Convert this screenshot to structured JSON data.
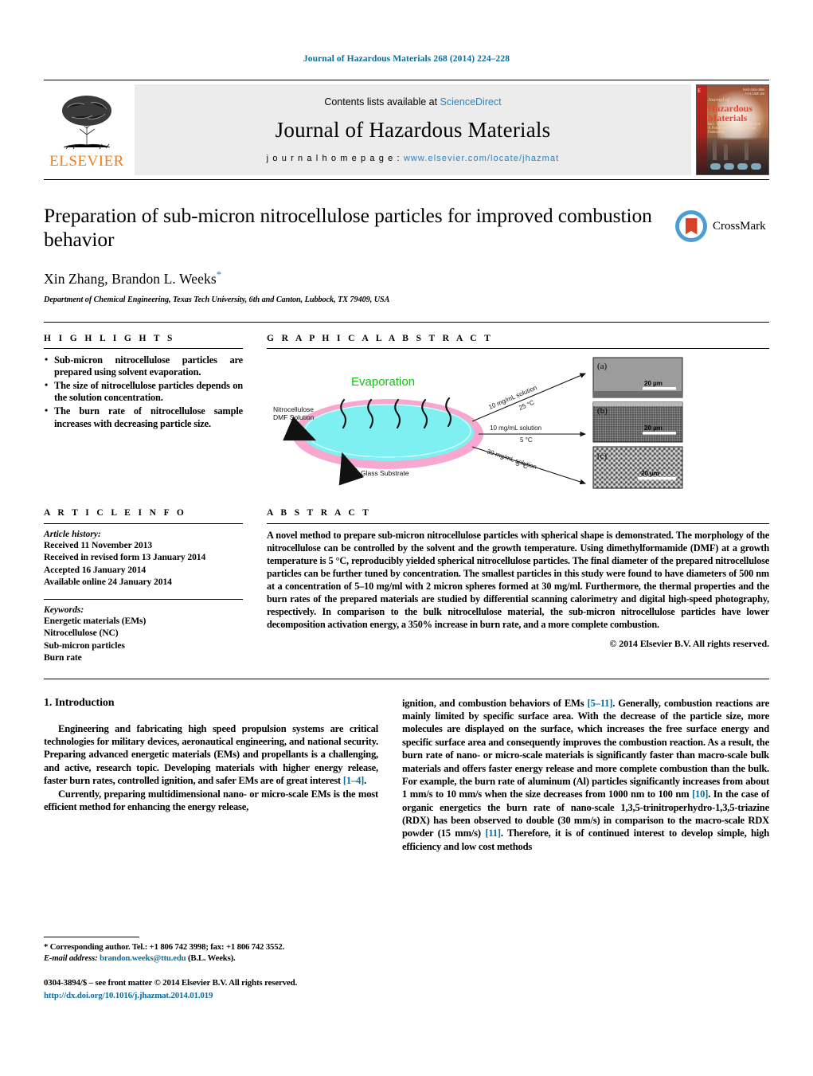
{
  "running_head": "Journal of Hazardous Materials 268 (2014) 224–228",
  "masthead": {
    "contents_prefix": "Contents lists available at ",
    "sciencedirect": "ScienceDirect",
    "journal_title": "Journal of Hazardous Materials",
    "homepage_prefix": "j o u r n a l   h o m e p a g e :   ",
    "homepage_url": "www.elsevier.com/locate/jhazmat",
    "elsevier_word": "ELSEVIER",
    "cover": {
      "line1": "Journal of",
      "line2": "Hazardous",
      "line3": "Materials",
      "line4": "Incl. Treatment and Management",
      "line5": "A Publication of the European Federation"
    }
  },
  "article": {
    "title": "Preparation of sub-micron nitrocellulose particles for improved combustion behavior",
    "authors": "Xin Zhang, Brandon L. Weeks",
    "affiliation": "Department of Chemical Engineering, Texas Tech University, 6th and Canton, Lubbock, TX 79409, USA",
    "crossmark_label": "CrossMark"
  },
  "highlights": {
    "heading": "H I G H L I G H T S",
    "items": [
      "Sub-micron nitrocellulose particles are prepared using solvent evaporation.",
      "The size of nitrocellulose particles depends on the solution concentration.",
      "The burn rate of nitrocellulose sample increases with decreasing particle size."
    ]
  },
  "graphical_abstract": {
    "heading": "G R A P H I C A L   A B S T R A C T",
    "evaporation_label": "Evaporation",
    "solution_label": "Nitrocellulose DMF Solution",
    "substrate_label": "Glass Substrate",
    "arrows": [
      {
        "concentration": "10 mg/mL solution",
        "temperature": "25 °C"
      },
      {
        "concentration": "10 mg/mL solution",
        "temperature": "5 °C"
      },
      {
        "concentration": "30 mg/mL solution",
        "temperature": "5 °C"
      }
    ],
    "panels": [
      {
        "label": "(a)",
        "scale_bar": "20 µm"
      },
      {
        "label": "(b)",
        "scale_bar": "20 µm"
      },
      {
        "label": "(c)",
        "scale_bar": "20 µm"
      }
    ]
  },
  "article_info": {
    "heading": "A R T I C L E   I N F O",
    "history_label": "Article history:",
    "history": [
      "Received 11 November 2013",
      "Received in revised form 13 January 2014",
      "Accepted 16 January 2014",
      "Available online 24 January 2014"
    ],
    "keywords_label": "Keywords:",
    "keywords": [
      "Energetic materials (EMs)",
      "Nitrocellulose (NC)",
      "Sub-micron particles",
      "Burn rate"
    ]
  },
  "abstract": {
    "heading": "A B S T R A C T",
    "text": "A novel method to prepare sub-micron nitrocellulose particles with spherical shape is demonstrated. The morphology of the nitrocellulose can be controlled by the solvent and the growth temperature. Using dimethylformamide (DMF) at a growth temperature is 5 °C, reproducibly yielded spherical nitrocellulose particles. The final diameter of the prepared nitrocellulose particles can be further tuned by concentration. The smallest particles in this study were found to have diameters of 500 nm at a concentration of 5–10 mg/ml with 2 micron spheres formed at 30 mg/ml. Furthermore, the thermal properties and the burn rates of the prepared materials are studied by differential scanning calorimetry and digital high-speed photography, respectively. In comparison to the bulk nitrocellulose material, the sub-micron nitrocellulose particles have lower decomposition activation energy, a 350% increase in burn rate, and a more complete combustion.",
    "copyright": "© 2014 Elsevier B.V. All rights reserved."
  },
  "introduction": {
    "section_number_title": "1.  Introduction",
    "para1_a": "Engineering and fabricating high speed propulsion systems are critical technologies for military devices, aeronautical engineering, and national security. Preparing advanced energetic materials (EMs) and propellants is a challenging, and active, research topic. Developing materials with higher energy release, faster burn rates, controlled ignition, and safer EMs are of great interest ",
    "para1_cite": "[1–4]",
    "para1_b": ".",
    "para2": "Currently, preparing multidimensional nano- or micro-scale EMs is the most efficient method for enhancing the energy release,",
    "right_a": "ignition, and combustion behaviors of EMs ",
    "right_cite1": "[5–11]",
    "right_b": ". Generally, combustion reactions are mainly limited by specific surface area. With the decrease of the particle size, more molecules are displayed on the surface, which increases the free surface energy and specific surface area and consequently improves the combustion reaction. As a result, the burn rate of nano- or micro-scale materials is significantly faster than macro-scale bulk materials and offers faster energy release and more complete combustion than the bulk. For example, the burn rate of aluminum (Al) particles significantly increases from about 1 mm/s to 10 mm/s when the size decreases from 1000 nm to 100 nm ",
    "right_cite2": "[10]",
    "right_c": ". In the case of organic energetics the burn rate of nano-scale 1,3,5-trinitroperhydro-1,3,5-triazine (RDX) has been observed to double (30 mm/s) in comparison to the macro-scale RDX powder (15 mm/s) ",
    "right_cite3": "[11]",
    "right_d": ". Therefore, it is of continued interest to develop simple, high efficiency and low cost methods"
  },
  "footnote": {
    "corresponding": "* Corresponding author. Tel.: +1 806 742 3998; fax: +1 806 742 3552.",
    "email_label": "E-mail address:",
    "email": "brandon.weeks@ttu.edu",
    "email_suffix": "(B.L. Weeks).",
    "issn_line": "0304-3894/$ – see front matter © 2014  Elsevier B.V. All rights reserved.",
    "doi": "http://dx.doi.org/10.1016/j.jhazmat.2014.01.019"
  }
}
